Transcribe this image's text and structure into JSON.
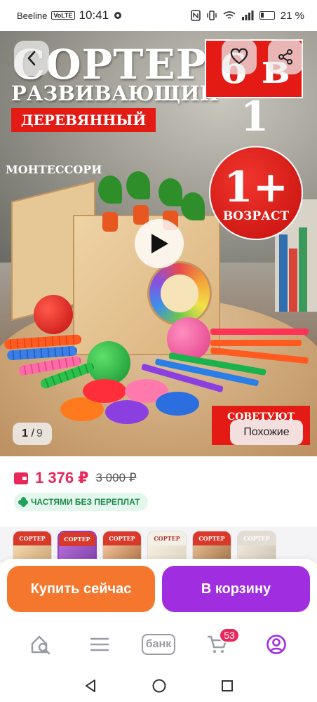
{
  "status_bar": {
    "carrier": "Beeline",
    "volte": "VoLTE",
    "time": "10:41",
    "battery": "21 %"
  },
  "hero": {
    "image_title": "СОРТЕР",
    "image_subtitle": "РАЗВИВАЮЩИЙ",
    "image_label": "ДЕРЕВЯННЫЙ",
    "badge_6v1": "6 в 1",
    "montessori": "МОНТЕССОРИ",
    "age_value": "1+",
    "age_label": "ВОЗРАСТ",
    "recommend": "СОВЕТУЮТ",
    "counter_current": "1",
    "counter_total": "9",
    "similar_label": "Похожие"
  },
  "price": {
    "current": "1 376 ₽",
    "old": "3 000 ₽",
    "installments": "ЧАСТЯМИ БЕЗ ПЕРЕПЛАТ"
  },
  "thumbnails": [
    {
      "top": "СОРТЕР",
      "color": "#d8392b"
    },
    {
      "top": "СОРТЕР",
      "color": "#d8392b"
    },
    {
      "top": "СОРТЕР",
      "color": "#c0392b"
    },
    {
      "top": "СОРТЕР",
      "color": "#f3f0e6"
    },
    {
      "top": "СОРТЕР",
      "color": "#d8392b"
    },
    {
      "top": "СОРТЕР",
      "color": "#e2dcd2"
    }
  ],
  "actions": {
    "buy_now": "Купить сейчас",
    "add_to_cart": "В корзину"
  },
  "bottom_nav": {
    "bank": "банк",
    "cart_count": "53"
  },
  "colors": {
    "accent_pink": "#e8285a",
    "buy_orange": "#f4772d",
    "cart_purple": "#a02de0",
    "promo_red": "#e41a14",
    "installments_green": "#1d8a4c"
  }
}
